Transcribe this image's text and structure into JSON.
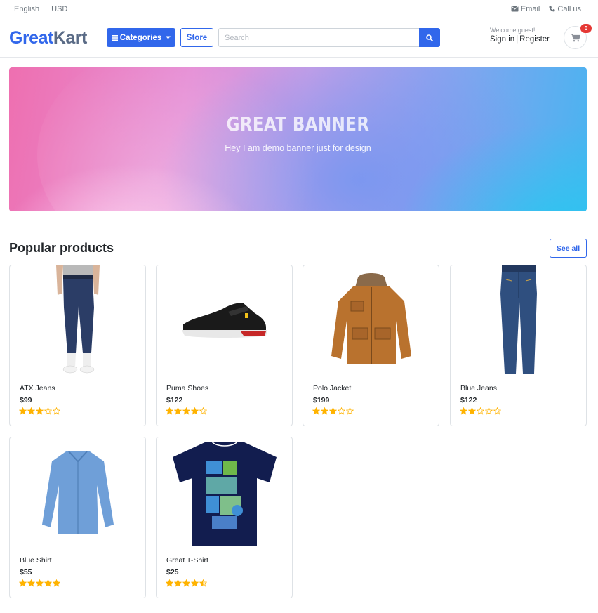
{
  "topbar": {
    "language": "English",
    "currency": "USD",
    "email_label": "Email",
    "call_label": "Call us"
  },
  "header": {
    "logo_part1": "Great",
    "logo_part2": "Kart",
    "categories_label": "Categories",
    "store_label": "Store",
    "search_placeholder": "Search",
    "welcome": "Welcome guest!",
    "signin": "Sign in",
    "register": "Register",
    "cart_count": "0"
  },
  "banner": {
    "title": "GREAT BANNER",
    "subtitle": "Hey I am demo banner just for design"
  },
  "section": {
    "title": "Popular products",
    "see_all": "See all"
  },
  "products": [
    {
      "name": "ATX Jeans",
      "price": "$99",
      "rating": 3,
      "icon": "jeans-model"
    },
    {
      "name": "Puma Shoes",
      "price": "$122",
      "rating": 4,
      "icon": "sneaker"
    },
    {
      "name": "Polo Jacket",
      "price": "$199",
      "rating": 3,
      "icon": "jacket"
    },
    {
      "name": "Blue Jeans",
      "price": "$122",
      "rating": 2,
      "icon": "jeans"
    },
    {
      "name": "Blue Shirt",
      "price": "$55",
      "rating": 5,
      "icon": "shirt"
    },
    {
      "name": "Great T-Shirt",
      "price": "$25",
      "rating": 4.5,
      "icon": "tshirt"
    }
  ],
  "colors": {
    "primary": "#3167eb",
    "star": "#ffb300",
    "badge": "#e53935"
  }
}
